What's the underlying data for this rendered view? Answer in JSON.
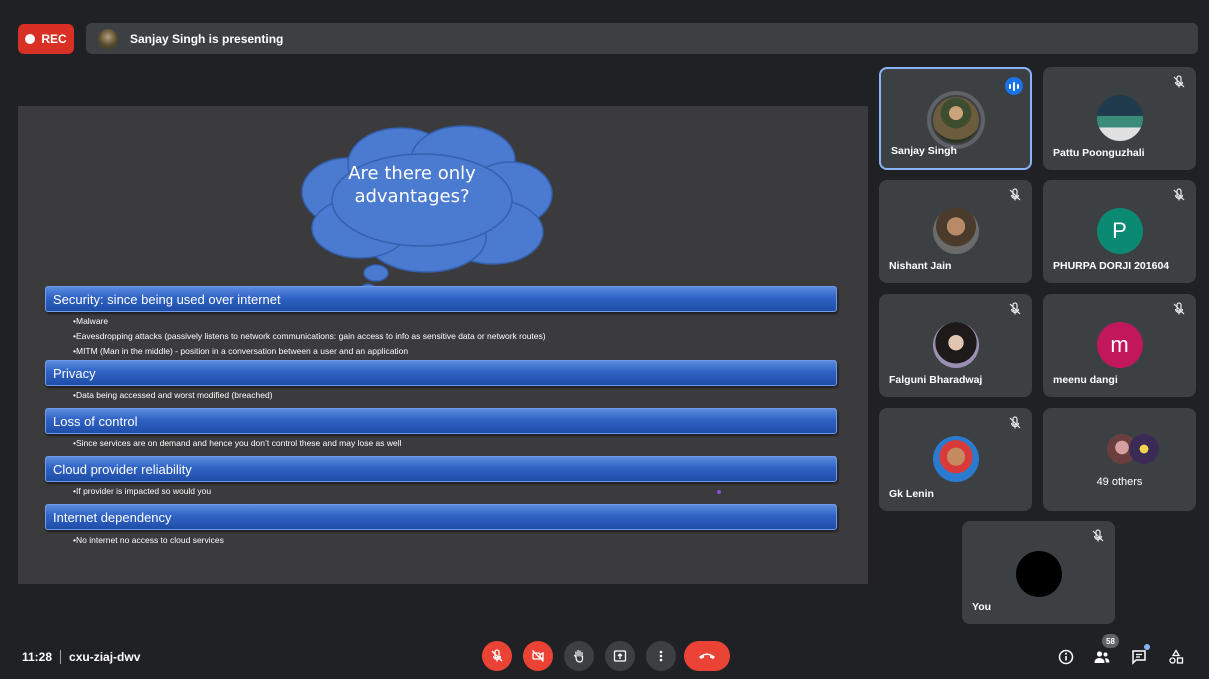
{
  "recording": {
    "label": "REC"
  },
  "presenting_banner": {
    "text": "Sanjay Singh is presenting"
  },
  "slide": {
    "cloud_title": "Are there only advantages?",
    "sections": [
      {
        "heading": "Security: since being used over internet",
        "bullets": [
          "Malware",
          "Eavesdropping attacks (passively listens to network communications: gain access to info as sensitive data or network routes)",
          "MITM (Man in the middle) - position in a conversation between a user and an application"
        ]
      },
      {
        "heading": "Privacy",
        "bullets": [
          "Data being accessed and worst modified (breached)"
        ]
      },
      {
        "heading": "Loss of control",
        "bullets": [
          "Since services are on demand and hence you don’t control these and may lose as well"
        ]
      },
      {
        "heading": "Cloud provider reliability",
        "bullets": [
          "If provider is impacted so would you"
        ]
      },
      {
        "heading": "Internet dependency",
        "bullets": [
          "No internet no access to cloud services"
        ]
      }
    ]
  },
  "participants": [
    {
      "name": "Sanjay Singh",
      "avatar": "photo",
      "speaking": true
    },
    {
      "name": "Pattu Poonguzhali",
      "avatar": "photo",
      "muted": true
    },
    {
      "name": "Nishant Jain",
      "avatar": "photo",
      "muted": true
    },
    {
      "name": "PHURPA DORJI 201604",
      "avatar_letter": "P",
      "avatar_color": "#0b8a73",
      "muted": true
    },
    {
      "name": "Falguni Bharadwaj",
      "avatar": "photo",
      "muted": true
    },
    {
      "name": "meenu dangi",
      "avatar_letter": "m",
      "avatar_color": "#c2185b",
      "muted": true
    },
    {
      "name": "Gk Lenin",
      "avatar": "photo",
      "muted": true
    },
    {
      "name": "49 others"
    },
    {
      "name": "You",
      "muted": true
    }
  ],
  "meeting": {
    "time": "11:28",
    "code": "cxu-ziaj-dwv"
  },
  "controls": {
    "mic": "mic-off-icon",
    "camera": "camera-off-icon",
    "hand": "raise-hand-icon",
    "present": "present-screen-icon",
    "more": "more-options-icon",
    "end": "end-call-icon"
  },
  "right_controls": {
    "people_count": "58"
  },
  "colors": {
    "accent": "#1a73e8",
    "danger": "#ea4335",
    "background": "#202124",
    "tile": "#3c4043"
  }
}
